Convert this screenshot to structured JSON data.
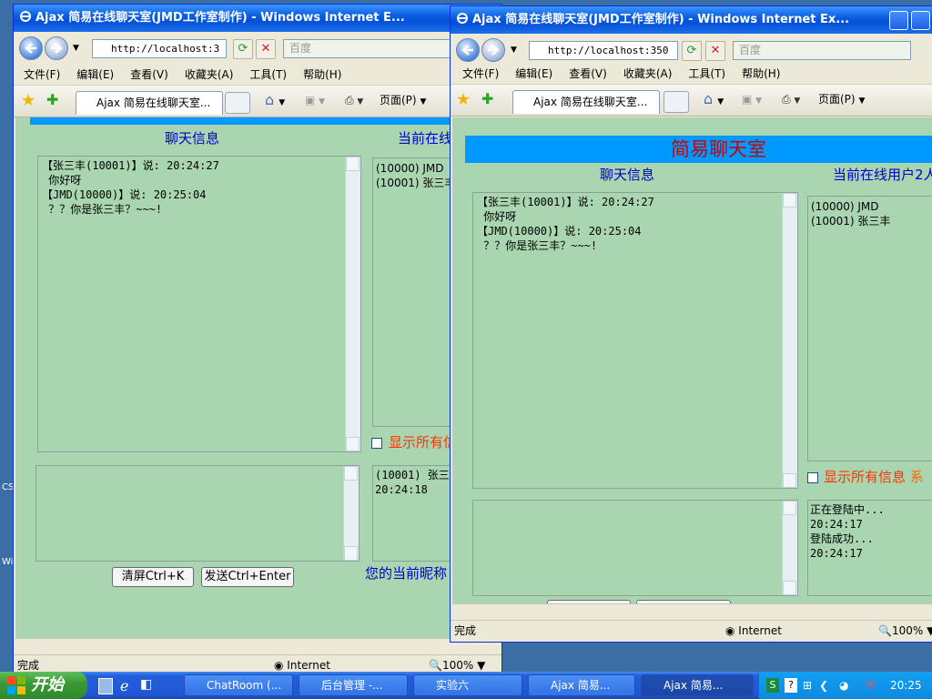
{
  "windows": {
    "title": "Ajax 简易在线聊天室(JMD工作室制作) - Windows Internet Explorer",
    "title_back": "Ajax 简易在线聊天室(JMD工作室制作) - Windows Internet E...",
    "title_front": "Ajax 简易在线聊天室(JMD工作室制作) - Windows Internet Ex...",
    "url_back": "http://localhost:3",
    "url_front": "http://localhost:350",
    "search_placeholder": "百度",
    "tab_label": "Ajax 简易在线聊天室...",
    "page_menu": "页面(P)",
    "zoom": "100%",
    "zone": "Internet",
    "status": "完成"
  },
  "menu": [
    "文件(F)",
    "编辑(E)",
    "查看(V)",
    "收藏夹(A)",
    "工具(T)",
    "帮助(H)"
  ],
  "chat": {
    "room_title": "简易聊天室",
    "chat_info_label": "聊天信息",
    "online_label_back": "当前在线",
    "online_label_front": "当前在线用户2人",
    "messages": [
      {
        "header": "【张三丰(10001)】说: 20:24:27",
        "body": " 你好呀"
      },
      {
        "header": "【JMD(10000)】说: 20:25:04",
        "body": " ？？你是张三丰？~~~!"
      }
    ],
    "online_users": [
      "(10000) JMD",
      "(10001) 张三丰"
    ],
    "show_all_label": "显示所有信息",
    "system_label": "系",
    "sys_messages_back": [
      "(10001) 张三",
      "20:24:18"
    ],
    "sys_messages_front": [
      "正在登陆中...",
      "20:24:17",
      "登陆成功...",
      "20:24:17"
    ],
    "clear_button": "清屏Ctrl+K",
    "send_button": "发送Ctrl+Enter",
    "nickname_label": "您的当前昵称",
    "nickname_label_front": "您的当前昵称"
  },
  "desktop": {
    "left_labels": [
      "CS",
      "Wi"
    ]
  },
  "taskbar": {
    "start": "开始",
    "tasks": [
      "ChatRoom (...",
      "后台管理 -...",
      "实验六",
      "Ajax 简易...",
      "Ajax 简易..."
    ],
    "clock": "20:25"
  }
}
